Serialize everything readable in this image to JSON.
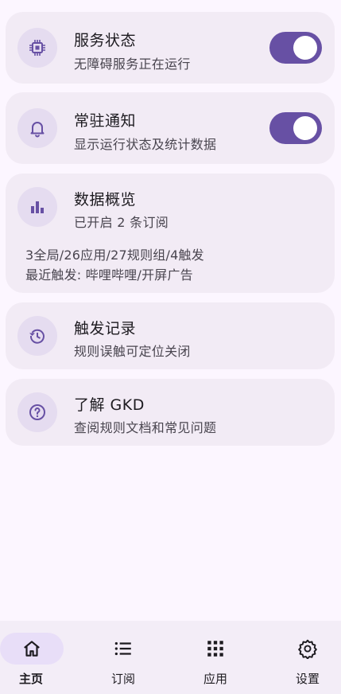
{
  "cards": {
    "service": {
      "title": "服务状态",
      "subtitle": "无障碍服务正在运行",
      "icon": "chip-icon",
      "toggle_on": true
    },
    "notify": {
      "title": "常驻通知",
      "subtitle": "显示运行状态及统计数据",
      "icon": "bell-icon",
      "toggle_on": true
    },
    "overview": {
      "title": "数据概览",
      "subtitle": "已开启 2 条订阅",
      "line1": "3全局/26应用/27规则组/4触发",
      "line2": "最近触发: 哔哩哔哩/开屏广告",
      "icon": "bar-chart-icon"
    },
    "records": {
      "title": "触发记录",
      "subtitle": "规则误触可定位关闭",
      "icon": "history-icon"
    },
    "about": {
      "title": "了解 GKD",
      "subtitle": "查阅规则文档和常见问题",
      "icon": "help-circle-icon"
    }
  },
  "nav": {
    "items": [
      {
        "label": "主页",
        "icon": "home-icon",
        "active": true
      },
      {
        "label": "订阅",
        "icon": "list-icon",
        "active": false
      },
      {
        "label": "应用",
        "icon": "apps-grid-icon",
        "active": false
      },
      {
        "label": "设置",
        "icon": "gear-icon",
        "active": false
      }
    ]
  },
  "colors": {
    "accent": "#6750a4",
    "card_bg": "#f2ebf5",
    "icon_bg": "#e5dcf0",
    "page_bg": "#fcf6ff"
  }
}
